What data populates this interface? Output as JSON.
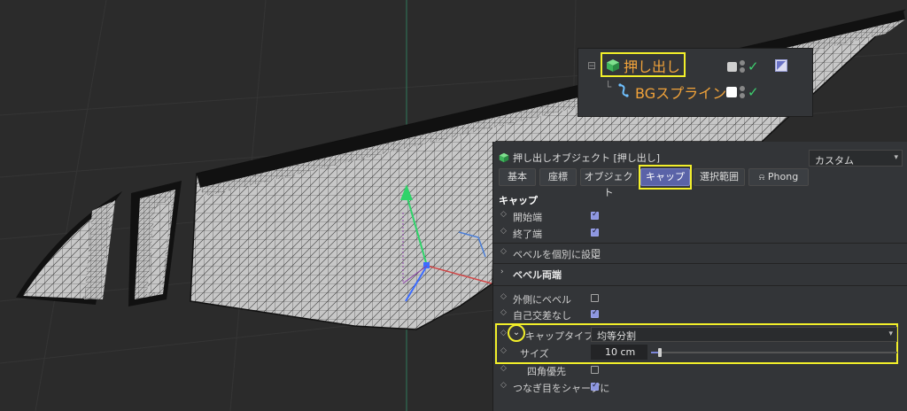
{
  "object_manager": {
    "items": [
      {
        "name": "押し出し",
        "icon": "extrude-cube-icon",
        "tag_color": "#f5f5f5"
      },
      {
        "name": "BGスプライン",
        "icon": "spline-icon",
        "tag_color": "#ffffff"
      }
    ],
    "highlight_color": "#f2ef2a",
    "name_color": "#f2a33a"
  },
  "attributes": {
    "title": "押し出しオブジェクト [押し出し]",
    "mode_dropdown": "カスタム",
    "tabs": [
      {
        "label": "基本",
        "active": false
      },
      {
        "label": "座標",
        "active": false
      },
      {
        "label": "オブジェクト",
        "active": false
      },
      {
        "label": "キャップ",
        "active": true
      },
      {
        "label": "選択範囲",
        "active": false
      },
      {
        "label": "Phong",
        "active": false
      }
    ],
    "section_title": "キャップ",
    "props": {
      "start_cap": {
        "label": "開始端",
        "checked": true
      },
      "end_cap": {
        "label": "終了端",
        "checked": true
      },
      "bevel_individual": {
        "label": "ベベルを個別に設定",
        "checked": false
      },
      "bevel_both_group": "ベベル両端",
      "outer_bevel": {
        "label": "外側にベベル",
        "checked": false
      },
      "avoid_self_intersect": {
        "label": "自己交差なし",
        "checked": true
      },
      "cap_type": {
        "label": "キャップタイプ",
        "value": "均等分割"
      },
      "size": {
        "label": "サイズ",
        "value": "10 cm",
        "slider_fraction": 0.03
      },
      "quad_dominant": {
        "label": "四角優先",
        "checked": false
      },
      "phong_break": {
        "label": "つなぎ目をシャープに",
        "checked": true
      }
    }
  },
  "colors": {
    "panel_bg": "#333538",
    "accent": "#5a63a8",
    "highlight": "#f2ef2a"
  }
}
